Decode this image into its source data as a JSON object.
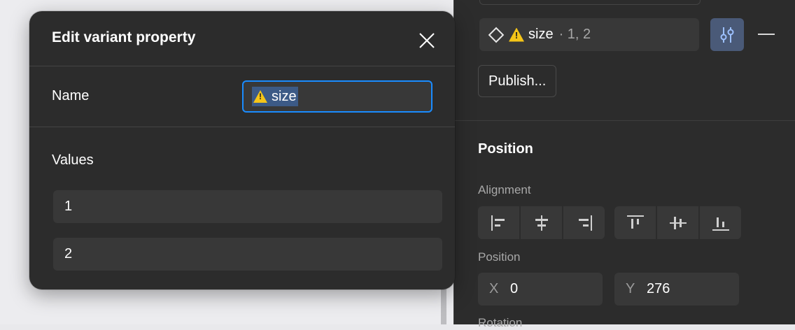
{
  "dialog": {
    "title": "Edit variant property",
    "name_label": "Name",
    "name_value": "size",
    "values_label": "Values",
    "values": [
      "1",
      "2"
    ]
  },
  "panel": {
    "variant_property": {
      "name": "size",
      "values_summary": "· 1, 2"
    },
    "publish_label": "Publish...",
    "position_section_title": "Position",
    "alignment_label": "Alignment",
    "position_label": "Position",
    "x_label": "X",
    "x_value": "0",
    "y_label": "Y",
    "y_value": "276",
    "rotation_label": "Rotation"
  },
  "colors": {
    "panel_bg": "#2c2c2c",
    "field_bg": "#383838",
    "focus_border": "#1a8cff",
    "selection_bg": "#3c5a86",
    "active_button_bg": "#4a5a78",
    "warning": "#f5c518",
    "muted_text": "#a8a8a8"
  },
  "icons": [
    "close-icon",
    "warning-icon",
    "diamond-variant-icon",
    "sliders-settings-icon",
    "minus-icon",
    "align-left-icon",
    "align-horizontal-center-icon",
    "align-right-icon",
    "align-top-icon",
    "align-vertical-center-icon",
    "align-bottom-icon"
  ]
}
